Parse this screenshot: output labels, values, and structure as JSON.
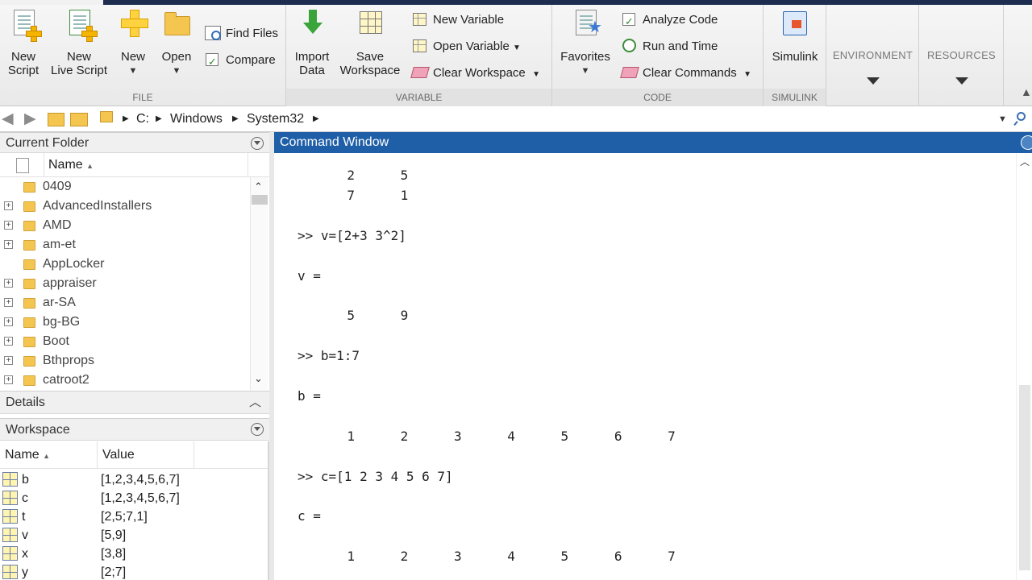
{
  "ribbon": {
    "file": {
      "label": "FILE",
      "new_script": [
        "New",
        "Script"
      ],
      "new_live_script": [
        "New",
        "Live Script"
      ],
      "new": "New",
      "open": "Open",
      "find_files": "Find Files",
      "compare": "Compare"
    },
    "variable": {
      "label": "VARIABLE",
      "import_data": [
        "Import",
        "Data"
      ],
      "save_workspace": [
        "Save",
        "Workspace"
      ],
      "new_variable": "New Variable",
      "open_variable": "Open Variable",
      "clear_workspace": "Clear Workspace"
    },
    "code": {
      "label": "CODE",
      "favorites": "Favorites",
      "analyze_code": "Analyze Code",
      "run_and_time": "Run and Time",
      "clear_commands": "Clear Commands"
    },
    "simulink": {
      "label": "SIMULINK",
      "simulink": "Simulink"
    },
    "environment": "ENVIRONMENT",
    "resources": "RESOURCES"
  },
  "address": {
    "path": [
      "C:",
      "Windows",
      "System32"
    ]
  },
  "current_folder": {
    "title": "Current Folder",
    "name_header": "Name",
    "items": [
      {
        "name": "0409",
        "expandable": false
      },
      {
        "name": "AdvancedInstallers",
        "expandable": true
      },
      {
        "name": "AMD",
        "expandable": true
      },
      {
        "name": "am-et",
        "expandable": true
      },
      {
        "name": "AppLocker",
        "expandable": false
      },
      {
        "name": "appraiser",
        "expandable": true
      },
      {
        "name": "ar-SA",
        "expandable": true
      },
      {
        "name": "bg-BG",
        "expandable": true
      },
      {
        "name": "Boot",
        "expandable": true
      },
      {
        "name": "Bthprops",
        "expandable": true
      },
      {
        "name": "catroot2",
        "expandable": true
      }
    ]
  },
  "details": {
    "title": "Details"
  },
  "workspace": {
    "title": "Workspace",
    "name_header": "Name",
    "value_header": "Value",
    "variables": [
      {
        "name": "b",
        "value": "[1,2,3,4,5,6,7]"
      },
      {
        "name": "c",
        "value": "[1,2,3,4,5,6,7]"
      },
      {
        "name": "t",
        "value": "[2,5;7,1]"
      },
      {
        "name": "v",
        "value": "[5,9]"
      },
      {
        "name": "x",
        "value": "[3,8]"
      },
      {
        "name": "y",
        "value": "[2;7]"
      }
    ]
  },
  "command_window": {
    "title": "Command Window",
    "lines": [
      {
        "type": "nums",
        "values": [
          "2",
          "5"
        ]
      },
      {
        "type": "nums",
        "values": [
          "7",
          "1"
        ]
      },
      {
        "type": "blank"
      },
      {
        "type": "text",
        "text": ">> v=[2+3 3^2]"
      },
      {
        "type": "blank"
      },
      {
        "type": "text",
        "text": "v ="
      },
      {
        "type": "blank"
      },
      {
        "type": "nums",
        "values": [
          "5",
          "9"
        ]
      },
      {
        "type": "blank"
      },
      {
        "type": "text",
        "text": ">> b=1:7"
      },
      {
        "type": "blank"
      },
      {
        "type": "text",
        "text": "b ="
      },
      {
        "type": "blank"
      },
      {
        "type": "nums",
        "values": [
          "1",
          "2",
          "3",
          "4",
          "5",
          "6",
          "7"
        ]
      },
      {
        "type": "blank"
      },
      {
        "type": "text",
        "text": ">> c=[1 2 3 4 5 6 7]"
      },
      {
        "type": "blank"
      },
      {
        "type": "text",
        "text": "c ="
      },
      {
        "type": "blank"
      },
      {
        "type": "nums",
        "values": [
          "1",
          "2",
          "3",
          "4",
          "5",
          "6",
          "7"
        ]
      }
    ]
  }
}
